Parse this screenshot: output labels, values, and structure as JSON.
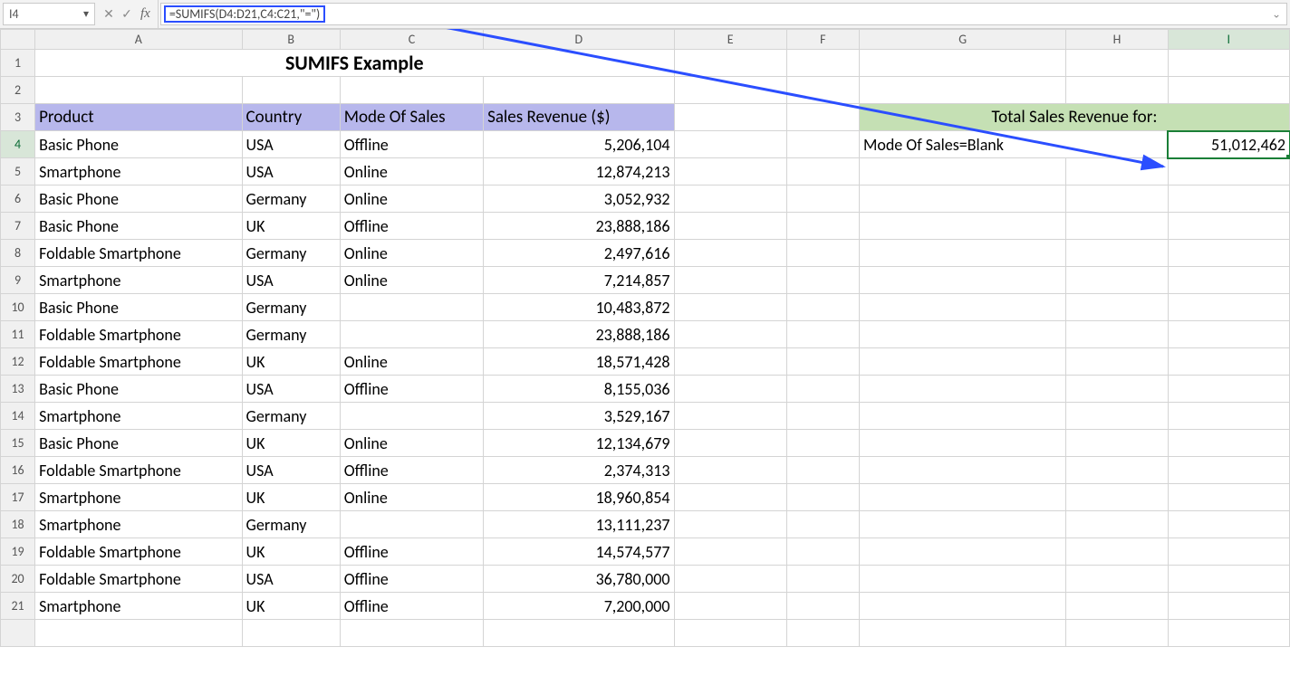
{
  "formula_bar": {
    "cell_ref": "I4",
    "formula": "=SUMIFS(D4:D21,C4:C21,\"=\")"
  },
  "columns": [
    "A",
    "B",
    "C",
    "D",
    "E",
    "F",
    "G",
    "H",
    "I"
  ],
  "title": "SUMIFS Example",
  "headers": {
    "A": "Product",
    "B": "Country",
    "C": "Mode Of Sales",
    "D": "Sales Revenue ($)"
  },
  "side": {
    "header": "Total Sales Revenue for:",
    "label": "Mode Of Sales=Blank",
    "result": "51,012,462"
  },
  "rows": [
    {
      "n": 4,
      "a": "Basic Phone",
      "b": "USA",
      "c": "Offline",
      "d": "5,206,104"
    },
    {
      "n": 5,
      "a": "Smartphone",
      "b": "USA",
      "c": "Online",
      "d": "12,874,213"
    },
    {
      "n": 6,
      "a": "Basic Phone",
      "b": "Germany",
      "c": "Online",
      "d": "3,052,932"
    },
    {
      "n": 7,
      "a": "Basic Phone",
      "b": "UK",
      "c": "Offline",
      "d": "23,888,186"
    },
    {
      "n": 8,
      "a": "Foldable Smartphone",
      "b": "Germany",
      "c": "Online",
      "d": "2,497,616"
    },
    {
      "n": 9,
      "a": "Smartphone",
      "b": "USA",
      "c": "Online",
      "d": "7,214,857"
    },
    {
      "n": 10,
      "a": "Basic Phone",
      "b": "Germany",
      "c": "",
      "d": "10,483,872"
    },
    {
      "n": 11,
      "a": "Foldable Smartphone",
      "b": "Germany",
      "c": "",
      "d": "23,888,186"
    },
    {
      "n": 12,
      "a": "Foldable Smartphone",
      "b": "UK",
      "c": "Online",
      "d": "18,571,428"
    },
    {
      "n": 13,
      "a": "Basic Phone",
      "b": "USA",
      "c": "Offline",
      "d": "8,155,036"
    },
    {
      "n": 14,
      "a": "Smartphone",
      "b": "Germany",
      "c": "",
      "d": "3,529,167"
    },
    {
      "n": 15,
      "a": "Basic Phone",
      "b": "UK",
      "c": "Online",
      "d": "12,134,679"
    },
    {
      "n": 16,
      "a": "Foldable Smartphone",
      "b": "USA",
      "c": "Offline",
      "d": "2,374,313"
    },
    {
      "n": 17,
      "a": "Smartphone",
      "b": "UK",
      "c": "Online",
      "d": "18,960,854"
    },
    {
      "n": 18,
      "a": "Smartphone",
      "b": "Germany",
      "c": "",
      "d": "13,111,237"
    },
    {
      "n": 19,
      "a": "Foldable Smartphone",
      "b": "UK",
      "c": "Offline",
      "d": "14,574,577"
    },
    {
      "n": 20,
      "a": "Foldable Smartphone",
      "b": "USA",
      "c": "Offline",
      "d": "36,780,000"
    },
    {
      "n": 21,
      "a": "Smartphone",
      "b": "UK",
      "c": "Offline",
      "d": "7,200,000"
    }
  ],
  "active": {
    "col": "I",
    "row": 4
  }
}
